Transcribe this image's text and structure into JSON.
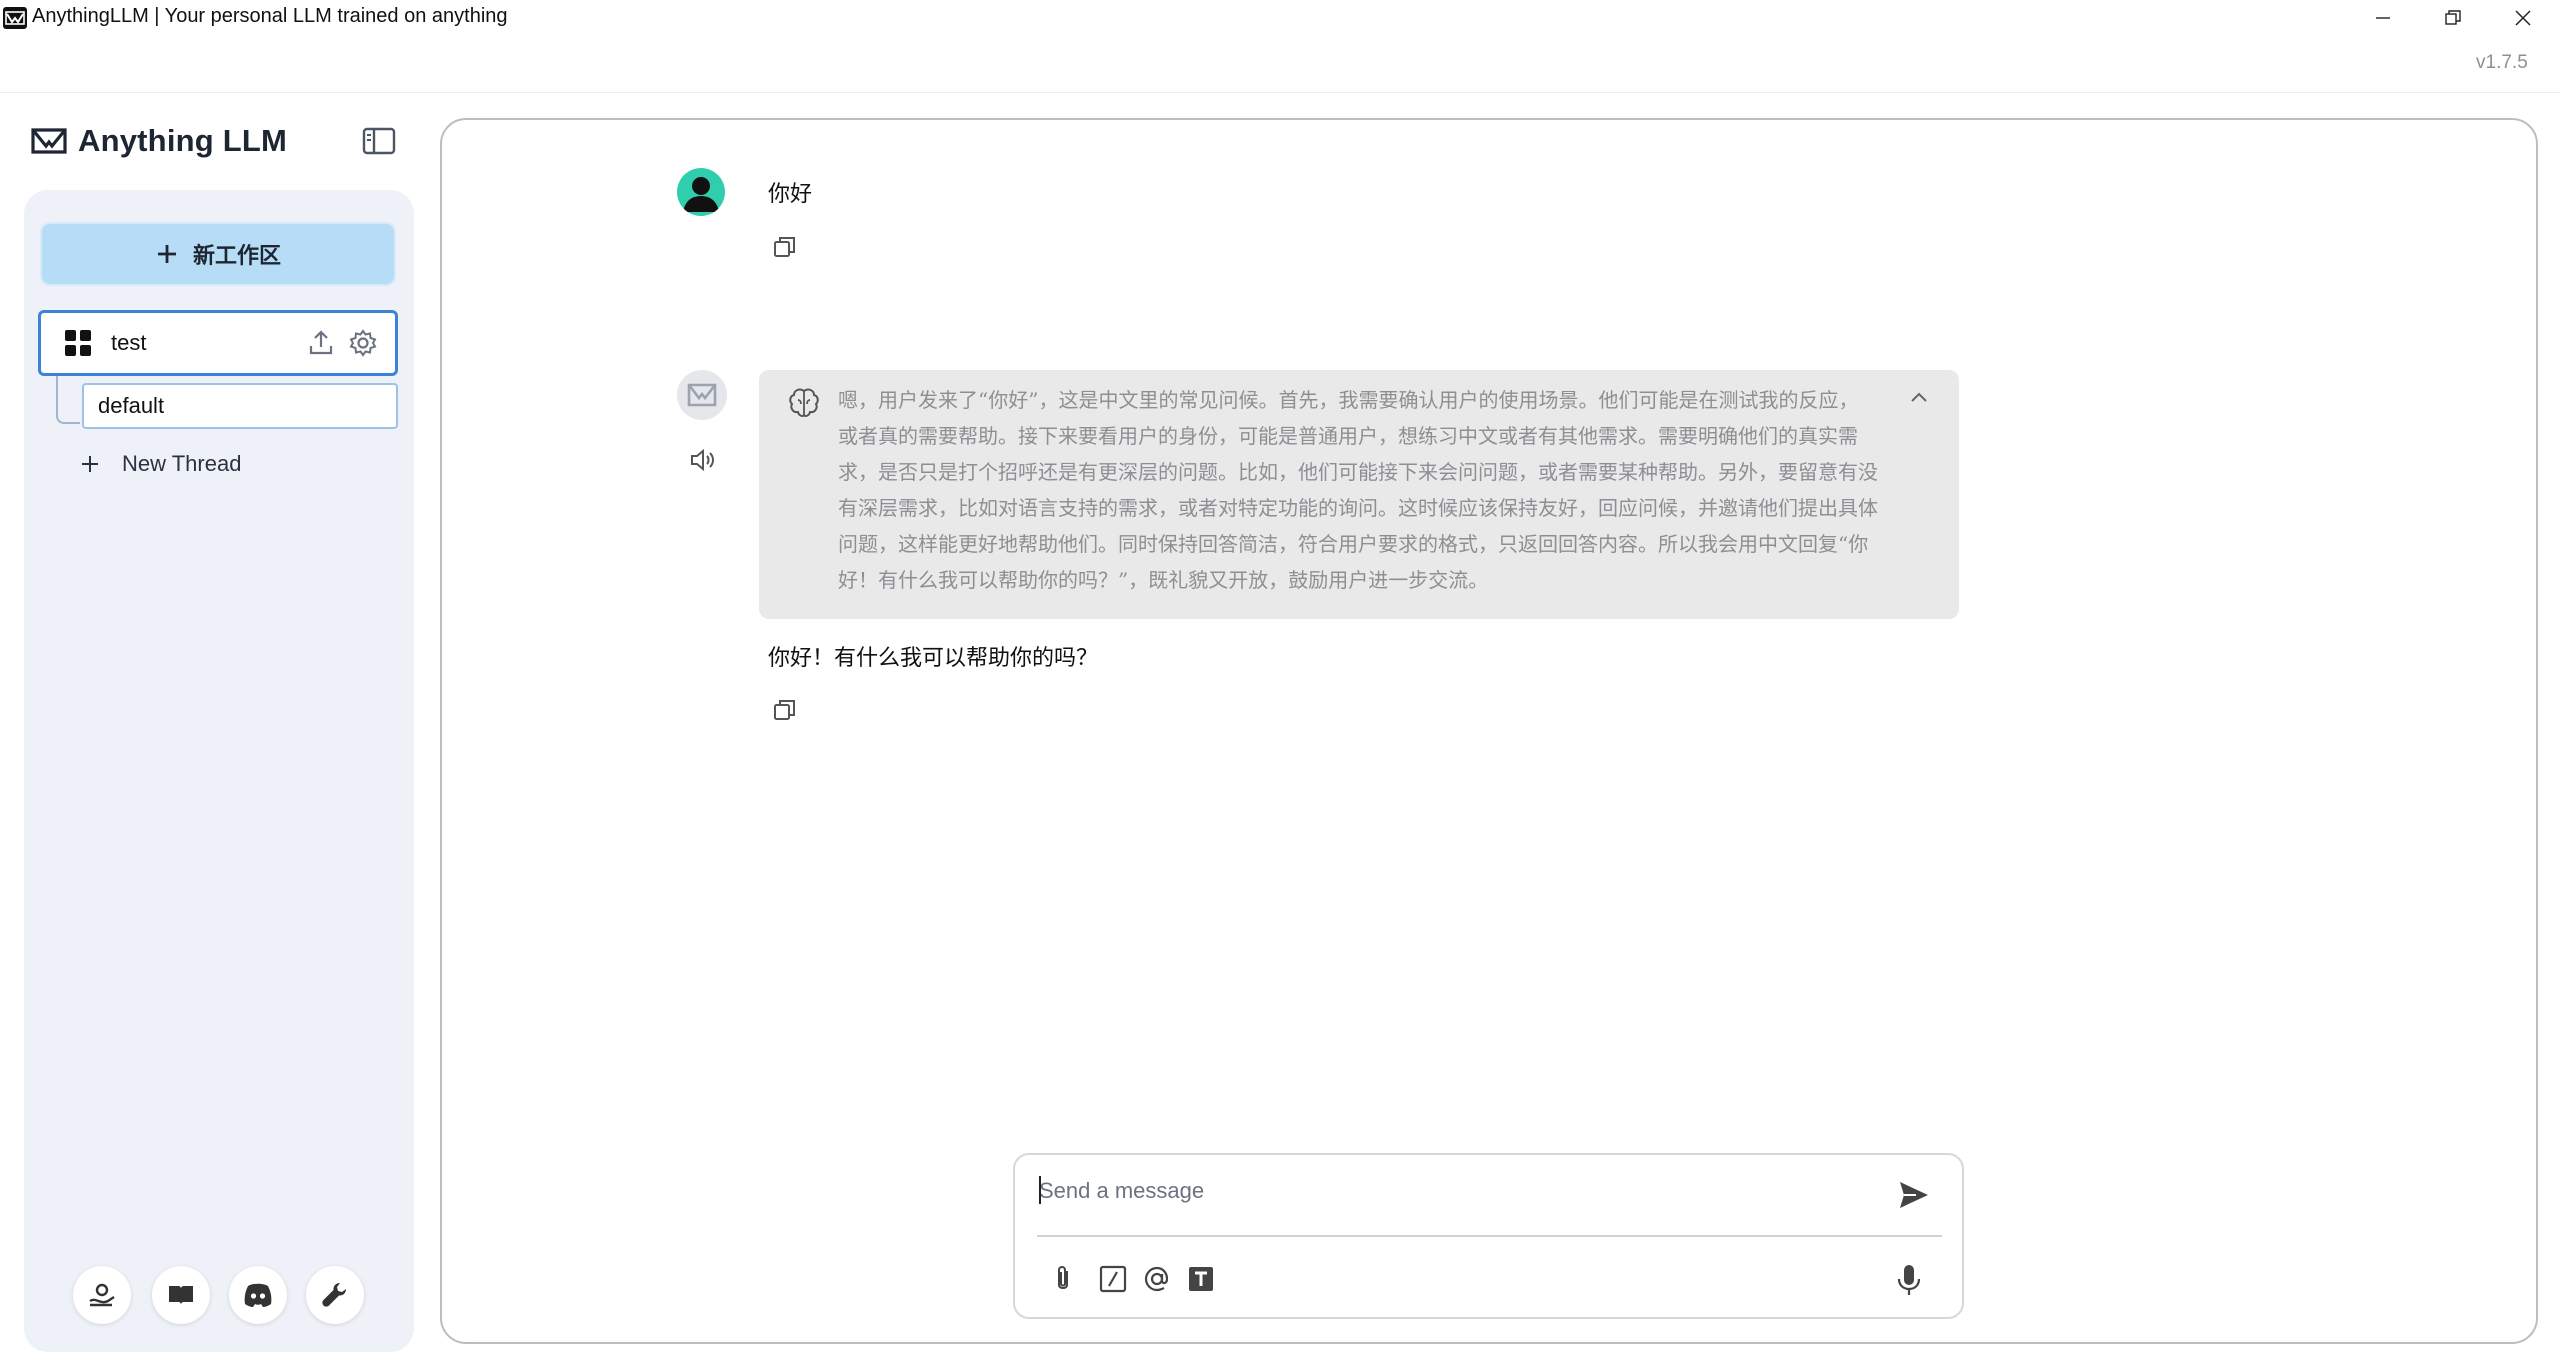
{
  "window": {
    "title": "AnythingLLM | Your personal LLM trained on anything",
    "version": "v1.7.5"
  },
  "brand": {
    "name": "Anything LLM"
  },
  "sidebar": {
    "new_workspace_label": "新工作区",
    "workspaces": [
      {
        "name": "test",
        "active": true
      }
    ],
    "threads": [
      {
        "name": "default",
        "active": true
      }
    ],
    "new_thread_label": "New Thread",
    "footer_icons": [
      "community-hub-icon",
      "docs-book-icon",
      "discord-icon",
      "settings-wrench-icon"
    ]
  },
  "chat": {
    "messages": [
      {
        "role": "user",
        "text": "你好"
      },
      {
        "role": "assistant",
        "thought": "嗯，用户发来了“你好”，这是中文里的常见问候。首先，我需要确认用户的使用场景。他们可能是在测试我的反应，或者真的需要帮助。接下来要看用户的身份，可能是普通用户，想练习中文或者有其他需求。需要明确他们的真实需求，是否只是打个招呼还是有更深层的问题。比如，他们可能接下来会问问题，或者需要某种帮助。另外，要留意有没有深层需求，比如对语言支持的需求，或者对特定功能的询问。这时候应该保持友好，回应问候，并邀请他们提出具体问题，这样能更好地帮助他们。同时保持回答简洁，符合用户要求的格式，只返回回答内容。所以我会用中文回复“你好！有什么我可以帮助你的吗？”，既礼貌又开放，鼓励用户进一步交流。",
        "text": "你好！有什么我可以帮助你的吗？"
      }
    ]
  },
  "composer": {
    "placeholder": "Send a message",
    "tools": [
      "attach-icon",
      "slash-command-icon",
      "at-mention-icon",
      "text-size-icon"
    ]
  },
  "colors": {
    "accent": "#3b82d8",
    "new_workspace_bg": "#b7dcf6",
    "sidebar_bg": "#eef1f7",
    "user_avatar": "#2fcfae",
    "thinking_bg": "#e9e9ea"
  }
}
